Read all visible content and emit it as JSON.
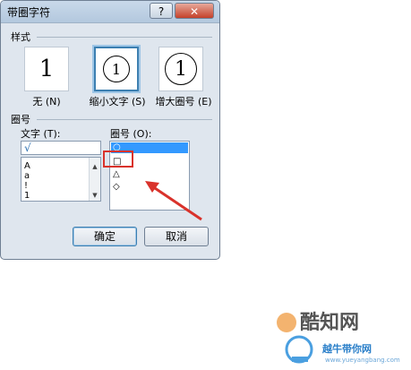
{
  "dialog": {
    "title": "带圈字符",
    "help_label": "?",
    "close_label": "✕",
    "style_section_label": "样式",
    "styles": [
      {
        "glyph": "1",
        "caption": "无 (N)"
      },
      {
        "glyph": "1",
        "caption": "缩小文字 (S)"
      },
      {
        "glyph": "1",
        "caption": "增大圈号 (E)"
      }
    ],
    "enclosure_section_label": "圈号",
    "text_label": "文字 (T):",
    "text_input_value": "√",
    "text_list": [
      "A",
      "a",
      "!",
      "1"
    ],
    "enclosure_label": "圈号 (O):",
    "enclosure_options": [
      "○",
      "□",
      "△",
      "◇"
    ],
    "ok_label": "确定",
    "cancel_label": "取消"
  },
  "watermark": {
    "brand_cn": "酷知网",
    "brand_sub": "越牛带你网",
    "brand_url": "www.yueyangbang.com"
  },
  "colors": {
    "annotation_red": "#d9322b",
    "selection_blue": "#3399ff"
  }
}
